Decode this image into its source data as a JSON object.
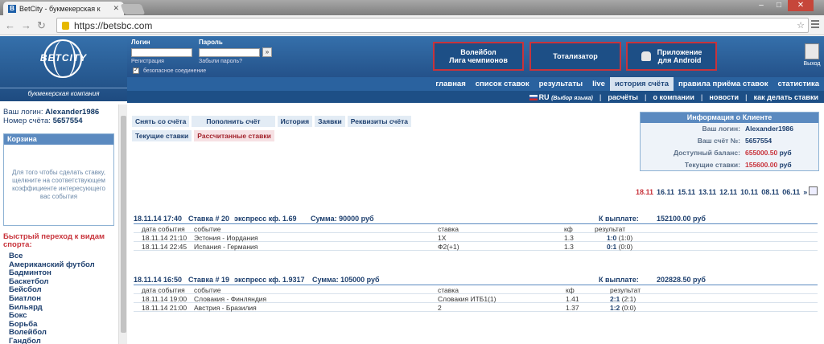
{
  "browser": {
    "tab_title": "BetCity - букмекерская к",
    "tab_favicon": "B",
    "url": "https://betsbc.com"
  },
  "header": {
    "logo": "BETCITY",
    "logo_sub": "букмекерская компания",
    "login_label": "Логин",
    "password_label": "Пароль",
    "register_link": "Регистрация",
    "forgot_link": "Забыли пароль?",
    "secure_label": "безопасное соединение",
    "go_label": "»",
    "promos": [
      {
        "line1": "Волейбол",
        "line2": "Лига чемпионов"
      },
      {
        "line1": "Тотализатор",
        "line2": ""
      },
      {
        "line1": "Приложение",
        "line2": "для Android"
      }
    ],
    "exit_label": "Выход"
  },
  "main_nav": [
    "главная",
    "список ставок",
    "результаты",
    "live",
    "история счёта",
    "правила приёма ставок",
    "статистика"
  ],
  "main_nav_active": 4,
  "sub_nav": {
    "lang": "RU",
    "lang_choice": "(Выбор языка)",
    "items": [
      "расчёты",
      "о компании",
      "новости",
      "как делать ставки"
    ]
  },
  "account": {
    "login_label": "Ваш логин:",
    "login": "Alexander1986",
    "number_label": "Номер счёта:",
    "number": "5657554"
  },
  "cart": {
    "title": "Корзина",
    "text": "Для того чтобы сделать ставку, щелкните на соответствующем коэффициенте интересующего вас события"
  },
  "quick_title": "Быстрый переход к видам спорта:",
  "sports": [
    "Все",
    "Американский футбол",
    "Бадминтон",
    "Баскетбол",
    "Бейсбол",
    "Биатлон",
    "Бильярд",
    "Бокс",
    "Борьба",
    "Волейбол",
    "Гандбол"
  ],
  "actions_row1": [
    "Снять со счёта",
    "Пополнить счёт",
    "История",
    "Заявки",
    "Реквизиты счёта"
  ],
  "actions_row2": [
    "Текущие ставки",
    "Рассчитанные ставки"
  ],
  "client_info": {
    "title": "Информация о Клиенте",
    "rows": [
      {
        "k": "Ваш логин:",
        "v": "Alexander1986"
      },
      {
        "k": "Ваш счёт №:",
        "v": "5657554"
      },
      {
        "k": "Доступный баланс:",
        "v": "655000.50",
        "unit": "руб"
      },
      {
        "k": "Текущие ставки:",
        "v": "155600.00",
        "unit": "руб"
      }
    ]
  },
  "dates": [
    "18.11",
    "16.11",
    "15.11",
    "13.11",
    "12.11",
    "10.11",
    "08.11",
    "06.11",
    "»"
  ],
  "columns": {
    "date": "дата события",
    "event": "событие",
    "bet": "ставка",
    "kf": "кф",
    "result": "результат"
  },
  "bets": [
    {
      "header": "18.11.14 17:40",
      "stake_no": "Ставка # 20",
      "type": "экспресс кф. 1.69",
      "sum": "Сумма: 90000 руб",
      "payout_label": "К выплате:",
      "payout": "152100.00 руб",
      "rows": [
        {
          "date": "18.11.14 21:10",
          "event": "Эстония - Иордания",
          "bet": "1X",
          "kf": "1.3",
          "score": "1:0",
          "detail": "(1:0)"
        },
        {
          "date": "18.11.14 22:45",
          "event": "Испания - Германия",
          "bet": "Ф2(+1)",
          "kf": "1.3",
          "score": "0:1",
          "detail": "(0:0)"
        }
      ]
    },
    {
      "header": "18.11.14 16:50",
      "stake_no": "Ставка # 19",
      "type": "экспресс кф. 1.9317",
      "sum": "Сумма: 105000 руб",
      "payout_label": "К выплате:",
      "payout": "202828.50 руб",
      "rows": [
        {
          "date": "18.11.14 19:00",
          "event": "Словакия - Финляндия",
          "bet": "Словакия ИТБ1(1)",
          "kf": "1.41",
          "score": "2:1",
          "detail": "(2:1)"
        },
        {
          "date": "18.11.14 21:00",
          "event": "Австрия - Бразилия",
          "bet": "2",
          "kf": "1.37",
          "score": "1:2",
          "detail": "(0:0)"
        }
      ]
    }
  ]
}
